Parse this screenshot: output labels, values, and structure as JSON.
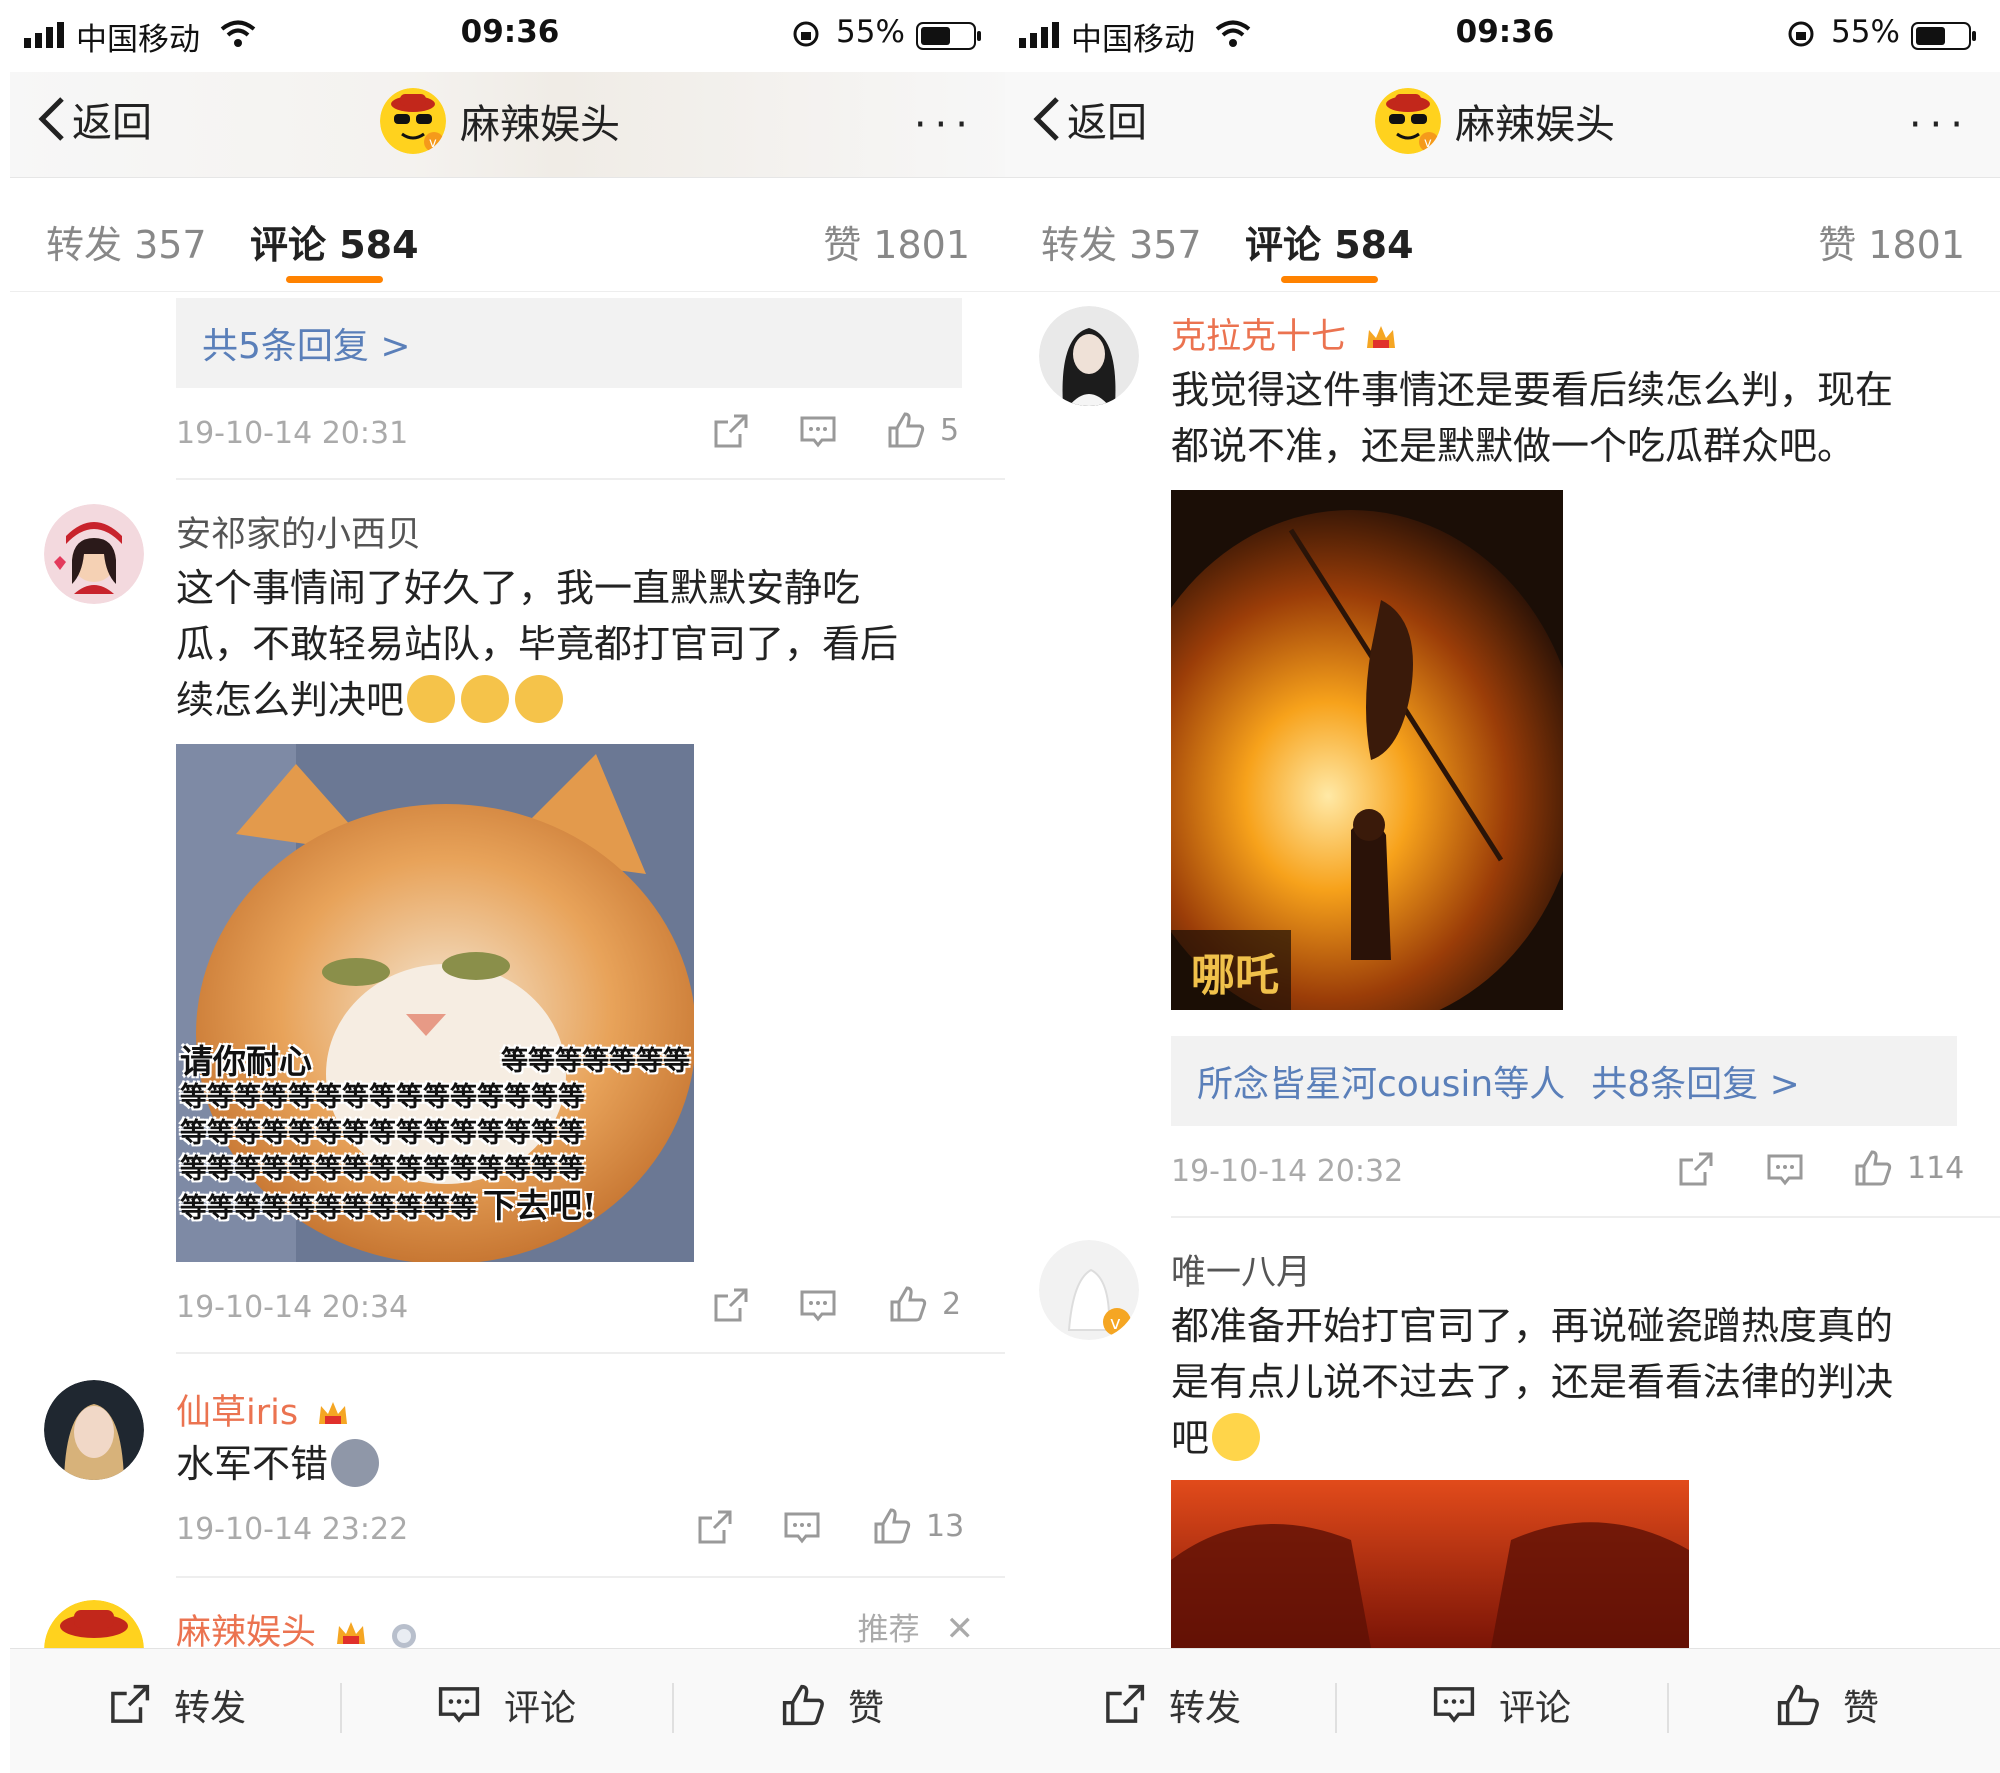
{
  "status": {
    "carrier": "中国移动",
    "time": "09:36",
    "battery": "55%"
  },
  "nav": {
    "back_label": "返回",
    "title": "麻辣娱头",
    "more_label": "···"
  },
  "tabs": {
    "repost": "转发 357",
    "comment": "评论 584",
    "like": "赞 1801"
  },
  "bottom": {
    "repost": "转发",
    "comment": "评论",
    "like": "赞"
  },
  "colors": {
    "accent": "#ff8200",
    "vip_name": "#eb7350",
    "link": "#5a7fb9"
  },
  "left": {
    "top_reply_link": "共5条回复 >",
    "top_meta": {
      "date": "19-10-14 20:31",
      "likes": "5"
    },
    "comments": [
      {
        "name": "安祁家的小西贝",
        "text_lines": [
          "这个事情闹了好久了，我一直默默安静吃",
          "瓜，不敢轻易站队，毕竟都打官司了，看后",
          "续怎么判决吧"
        ],
        "image": {
          "caption_left": "请你耐心",
          "caption_right": "等等等等等等等",
          "caption_rows": [
            "等等等等等等等等等等等等等等等",
            "等等等等等等等等等等等等等等等",
            "等等等等等等等等等等等等等等等",
            "等等等等等等等等等等等"
          ],
          "caption_end": "下去吧!"
        },
        "date": "19-10-14 20:34",
        "likes": "2"
      },
      {
        "name": "仙草iris",
        "text": "水军不错",
        "date": "19-10-14 23:22",
        "likes": "13"
      },
      {
        "name": "麻辣娱头",
        "recommend": "推荐"
      }
    ]
  },
  "right": {
    "comments": [
      {
        "name": "克拉克十七",
        "text_lines": [
          "我觉得这件事情还是要看后续怎么判，现在",
          "都说不准，还是默默做一个吃瓜群众吧。"
        ],
        "reply_link_user": "所念皆星河cousin等人",
        "reply_link_count": "共8条回复 >",
        "date": "19-10-14 20:32",
        "likes": "114"
      },
      {
        "name": "唯一八月",
        "text_lines": [
          "都准备开始打官司了，再说碰瓷蹭热度真的",
          "是有点儿说不过去了，还是看看法律的判决",
          "吧"
        ]
      }
    ]
  }
}
